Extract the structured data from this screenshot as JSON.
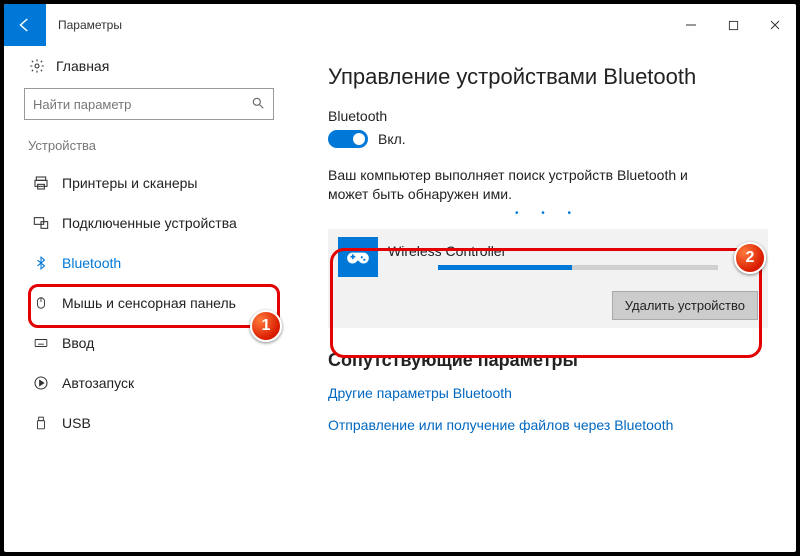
{
  "window": {
    "title": "Параметры"
  },
  "sidebar": {
    "home": "Главная",
    "search_placeholder": "Найти параметр",
    "section": "Устройства",
    "items": [
      {
        "label": "Принтеры и сканеры"
      },
      {
        "label": "Подключенные устройства"
      },
      {
        "label": "Bluetooth"
      },
      {
        "label": "Мышь и сенсорная панель"
      },
      {
        "label": "Ввод"
      },
      {
        "label": "Автозапуск"
      },
      {
        "label": "USB"
      }
    ]
  },
  "content": {
    "heading": "Управление устройствами Bluetooth",
    "bt_label": "Bluetooth",
    "bt_state": "Вкл.",
    "desc": "Ваш компьютер выполняет поиск устройств Bluetooth и может быть обнаружен ими.",
    "device": {
      "name": "Wireless Controller",
      "remove": "Удалить устройство",
      "progress_percent": 48
    },
    "sub_heading": "Сопутствующие параметры",
    "link_more": "Другие параметры Bluetooth",
    "link_files": "Отправление или получение файлов через Bluetooth"
  },
  "annotations": {
    "badge1": "1",
    "badge2": "2"
  }
}
